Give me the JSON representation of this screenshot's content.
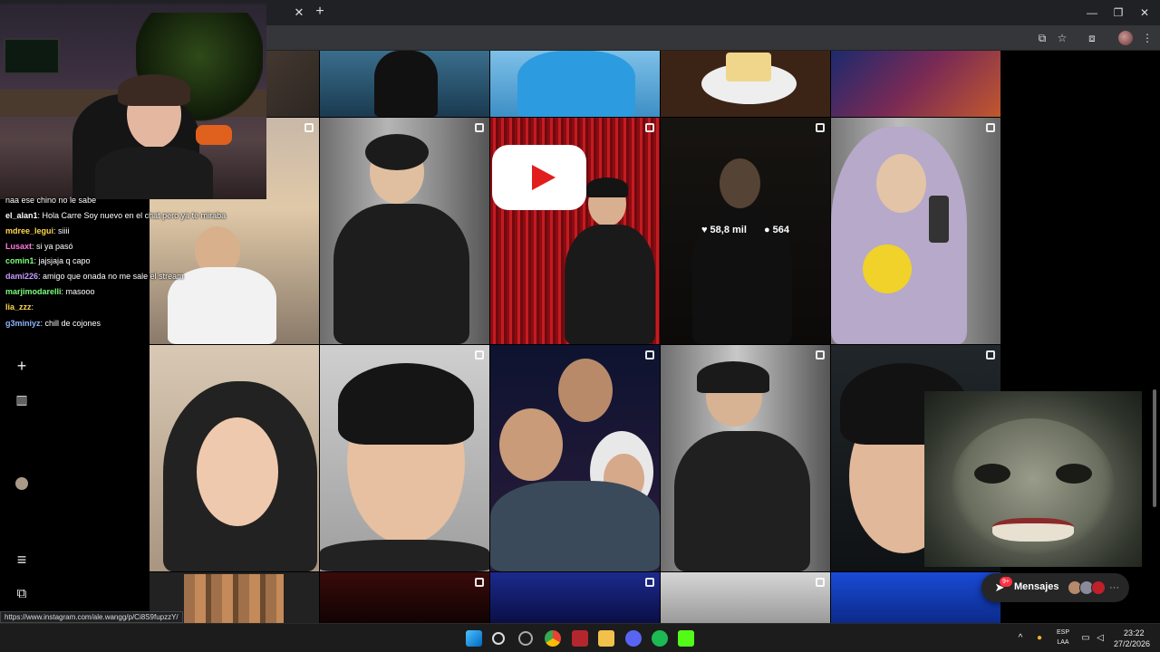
{
  "browser": {
    "tab_close": "✕",
    "new_tab": "+",
    "window_controls": {
      "minimize": "—",
      "maximize": "❐",
      "close": "✕"
    },
    "toolbar_icons": {
      "cast": "⧉",
      "bookmark": "☆",
      "extensions": "⧈",
      "menu": "⋮"
    }
  },
  "sidebar": {
    "items": [
      {
        "name": "create",
        "icon": "+"
      },
      {
        "name": "insights",
        "icon": "▥"
      },
      {
        "name": "profile",
        "icon": "avatar"
      },
      {
        "name": "more",
        "icon": "≡"
      },
      {
        "name": "also-from-meta",
        "icon": "⧉"
      }
    ]
  },
  "grid": {
    "hovered_post": {
      "likes": "58,8 mil",
      "comments": "564"
    }
  },
  "messages": {
    "label": "Mensajes",
    "badge": "9+",
    "more": "···"
  },
  "chat": {
    "lines": [
      {
        "user": "",
        "text": "naa ese chino no le sabe",
        "color": "#ff6b6b"
      },
      {
        "user": "el_alan1",
        "text": ": Hola Carre Soy nuevo en el chat pero ya te miraba",
        "color": "#ffffff"
      },
      {
        "user": "mdree_legui",
        "text": ": siiii",
        "color": "#ffd84d"
      },
      {
        "user": "Lusaxt",
        "text": ": si ya pasó",
        "color": "#ff7be0"
      },
      {
        "user": "comin1",
        "text": ": jajsjaja q capo",
        "color": "#7bff7b"
      },
      {
        "user": "dami226",
        "text": ": amigo que onada no me sale el stream",
        "color": "#c79bff"
      },
      {
        "user": "marjimodarelli",
        "text": ": masooo",
        "color": "#7bff7b"
      },
      {
        "user": "lia_zzz",
        "text": ":",
        "color": "#ffd84d"
      },
      {
        "user": "g3miniyz",
        "text": ": chill de cojones",
        "color": "#8fb6ff"
      }
    ]
  },
  "status_url": "https://www.instagram.com/ale.wangg/p/Ci8S9fupzzY/",
  "taskbar": {
    "lang_top": "ESP",
    "lang_bottom": "LAA",
    "time": "23:22",
    "date": "27/2/2026"
  }
}
